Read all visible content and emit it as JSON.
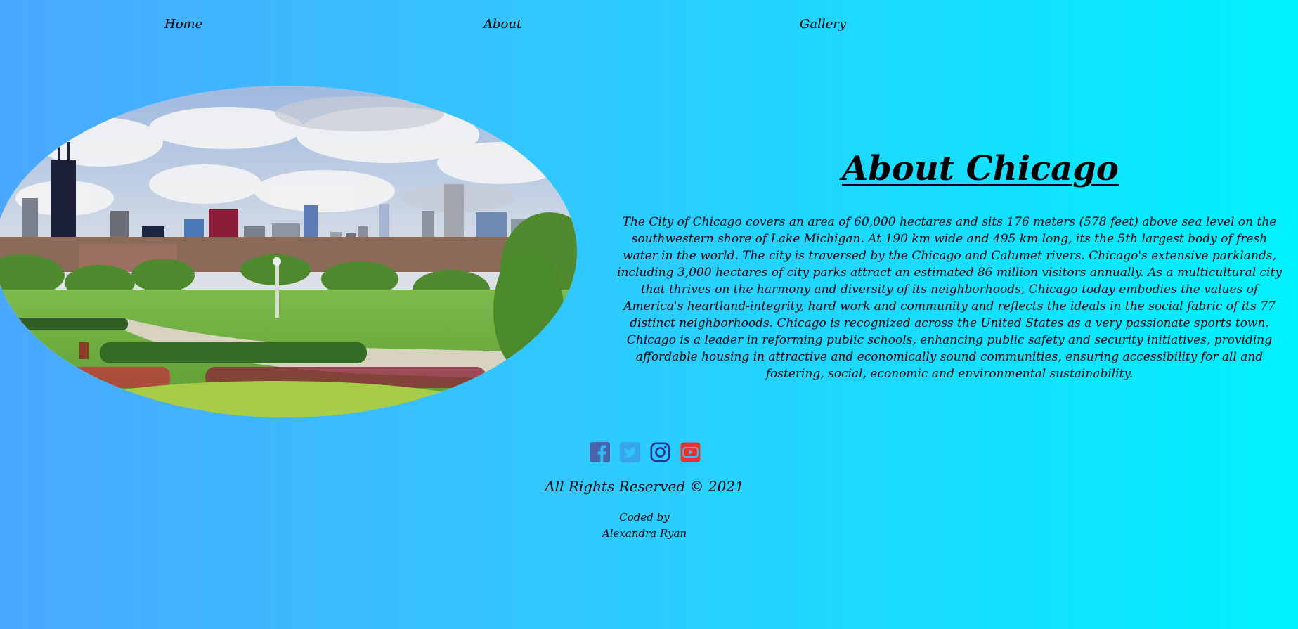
{
  "nav": {
    "home": "Home",
    "about": "About",
    "gallery": "Gallery"
  },
  "hero_image": {
    "subject": "Chicago skyline viewed across a green park",
    "icon": "skyline-photo"
  },
  "about": {
    "title": "About Chicago",
    "text": "The City of Chicago covers an area of 60,000 hectares and sits 176 meters (578 feet) above sea level on the southwestern shore of Lake Michigan. At 190 km wide and 495 km long, its the 5th largest body of fresh water in the world. The city is traversed by the Chicago and Calumet rivers. Chicago's extensive parklands, including 3,000 hectares of city parks attract an estimated 86 million visitors annually. As a multicultural city that thrives on the harmony and diversity of its neighborhoods, Chicago today embodies the values of America's heartland-integrity, hard work and community and reflects the ideals in the social fabric of its 77 distinct neighborhoods. Chicago is recognized across the United States as a very passionate sports town. Chicago is a leader in reforming public schools, enhancing public safety and security initiatives, providing affordable housing in attractive and economically sound communities, ensuring accessibility for all and fostering, social, economic and environmental sustainability."
  },
  "social": [
    {
      "name": "facebook-icon",
      "color": "#3b5998"
    },
    {
      "name": "twitter-icon",
      "color": "#1da1f2"
    },
    {
      "name": "instagram-icon",
      "color": "#3f2a9e"
    },
    {
      "name": "youtube-icon",
      "color": "#ff0000"
    }
  ],
  "footer": {
    "rights": "All Rights Reserved © 2021",
    "coded_by": "Coded by",
    "author": "Alexandra Ryan"
  }
}
